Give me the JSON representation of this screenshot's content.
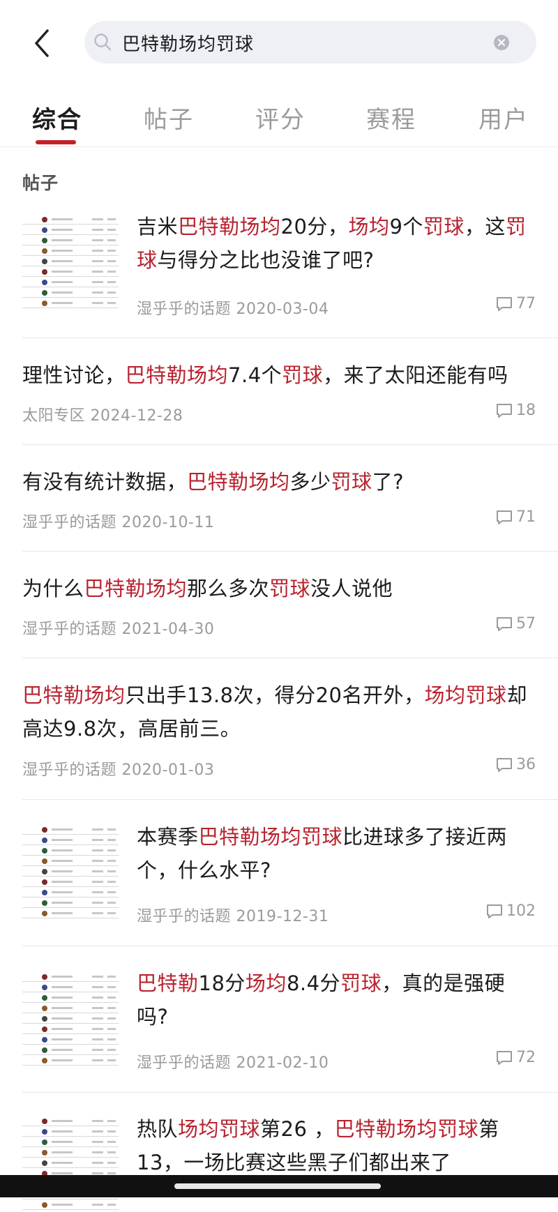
{
  "search": {
    "query": "巴特勒场均罚球",
    "icon": "search-icon",
    "clear_icon": "clear-icon"
  },
  "tabs": [
    {
      "label": "综合",
      "active": true
    },
    {
      "label": "帖子",
      "active": false
    },
    {
      "label": "评分",
      "active": false
    },
    {
      "label": "赛程",
      "active": false
    },
    {
      "label": "用户",
      "active": false
    }
  ],
  "section_label": "帖子",
  "accent_color": "#b8232f",
  "posts": [
    {
      "title_parts": [
        {
          "t": "吉米",
          "hl": false
        },
        {
          "t": "巴特勒场均",
          "hl": true
        },
        {
          "t": "20分，",
          "hl": false
        },
        {
          "t": "场均",
          "hl": true
        },
        {
          "t": "9个",
          "hl": false
        },
        {
          "t": "罚球",
          "hl": true
        },
        {
          "t": "，这",
          "hl": false
        },
        {
          "t": "罚球",
          "hl": true
        },
        {
          "t": "与得分之比也没谁了吧?",
          "hl": false
        }
      ],
      "source": "湿乎乎的话题",
      "date": "2020-03-04",
      "comments": "77",
      "has_thumb": true
    },
    {
      "title_parts": [
        {
          "t": "理性讨论，",
          "hl": false
        },
        {
          "t": "巴特勒场均",
          "hl": true
        },
        {
          "t": "7.4个",
          "hl": false
        },
        {
          "t": "罚球",
          "hl": true
        },
        {
          "t": "，来了太阳还能有吗",
          "hl": false
        }
      ],
      "source": "太阳专区",
      "date": "2024-12-28",
      "comments": "18",
      "has_thumb": false
    },
    {
      "title_parts": [
        {
          "t": "有没有统计数据，",
          "hl": false
        },
        {
          "t": "巴特勒场均",
          "hl": true
        },
        {
          "t": "多少",
          "hl": false
        },
        {
          "t": "罚球",
          "hl": true
        },
        {
          "t": "了?",
          "hl": false
        }
      ],
      "source": "湿乎乎的话题",
      "date": "2020-10-11",
      "comments": "71",
      "has_thumb": false
    },
    {
      "title_parts": [
        {
          "t": "为什么",
          "hl": false
        },
        {
          "t": "巴特勒场均",
          "hl": true
        },
        {
          "t": "那么多次",
          "hl": false
        },
        {
          "t": "罚球",
          "hl": true
        },
        {
          "t": "没人说他",
          "hl": false
        }
      ],
      "source": "湿乎乎的话题",
      "date": "2021-04-30",
      "comments": "57",
      "has_thumb": false
    },
    {
      "title_parts": [
        {
          "t": "巴特勒场均",
          "hl": true
        },
        {
          "t": "只出手13.8次，得分20名开外，",
          "hl": false
        },
        {
          "t": "场均罚球",
          "hl": true
        },
        {
          "t": "却高达9.8次，高居前三。",
          "hl": false
        }
      ],
      "source": "湿乎乎的话题",
      "date": "2020-01-03",
      "comments": "36",
      "has_thumb": false
    },
    {
      "title_parts": [
        {
          "t": "本赛季",
          "hl": false
        },
        {
          "t": "巴特勒场均罚球",
          "hl": true
        },
        {
          "t": "比进球多了接近两个，什么水平?",
          "hl": false
        }
      ],
      "source": "湿乎乎的话题",
      "date": "2019-12-31",
      "comments": "102",
      "has_thumb": true
    },
    {
      "title_parts": [
        {
          "t": "巴特勒",
          "hl": true
        },
        {
          "t": "18分",
          "hl": false
        },
        {
          "t": "场均",
          "hl": true
        },
        {
          "t": "8.4分",
          "hl": false
        },
        {
          "t": "罚球",
          "hl": true
        },
        {
          "t": "，真的是强硬吗?",
          "hl": false
        }
      ],
      "source": "湿乎乎的话题",
      "date": "2021-02-10",
      "comments": "72",
      "has_thumb": true
    },
    {
      "title_parts": [
        {
          "t": "热队",
          "hl": false
        },
        {
          "t": "场均罚球",
          "hl": true
        },
        {
          "t": "第26 ，",
          "hl": false
        },
        {
          "t": "巴特勒场均罚球",
          "hl": true
        },
        {
          "t": "第13，一场比赛这些黑子们都出来了",
          "hl": false
        }
      ],
      "source": "",
      "date": "",
      "comments": "",
      "has_thumb": true
    }
  ]
}
